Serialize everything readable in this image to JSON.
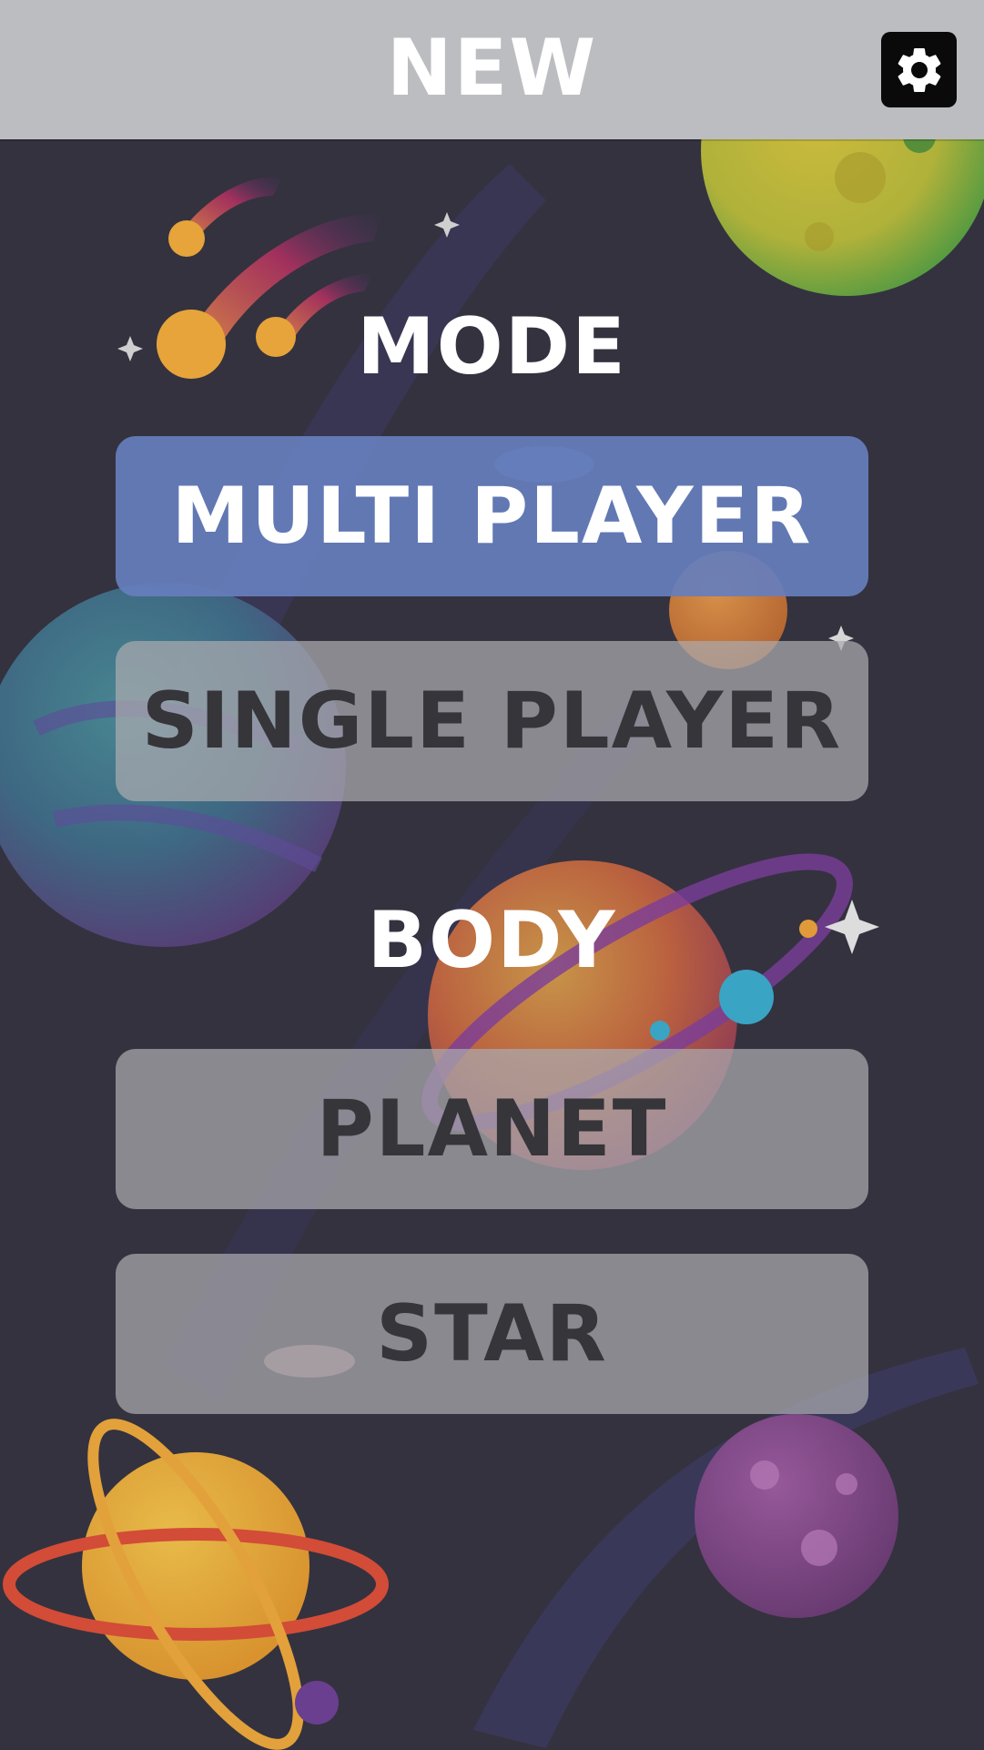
{
  "header": {
    "title": "NEW",
    "settings_icon": "gear-icon"
  },
  "mode": {
    "label": "MODE",
    "options": [
      {
        "label": "MULTI PLAYER",
        "selected": true
      },
      {
        "label": "SINGLE PLAYER",
        "selected": false
      }
    ]
  },
  "body_type": {
    "label": "BODY",
    "options": [
      {
        "label": "PLANET",
        "selected": false
      },
      {
        "label": "STAR",
        "selected": false
      }
    ]
  },
  "colors": {
    "background": "#34323f",
    "header": "#bcbdc1",
    "selected_button": "#667ebc",
    "unselected_button": "#aaaaae",
    "selected_text": "#ffffff",
    "unselected_text": "#363539"
  }
}
